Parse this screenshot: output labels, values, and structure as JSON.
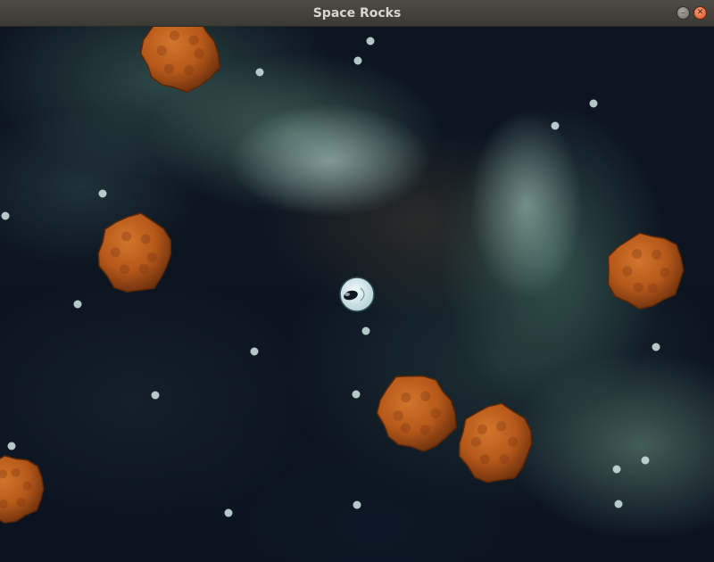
{
  "window": {
    "title": "Space Rocks",
    "minimize_label": "–",
    "close_label": "✕"
  },
  "game": {
    "player": {
      "icon": "ship-icon"
    },
    "asteroid_color": "#b5581a",
    "star_color": "#c8dcdc",
    "asteroid_count": 7,
    "star_count": 24
  }
}
